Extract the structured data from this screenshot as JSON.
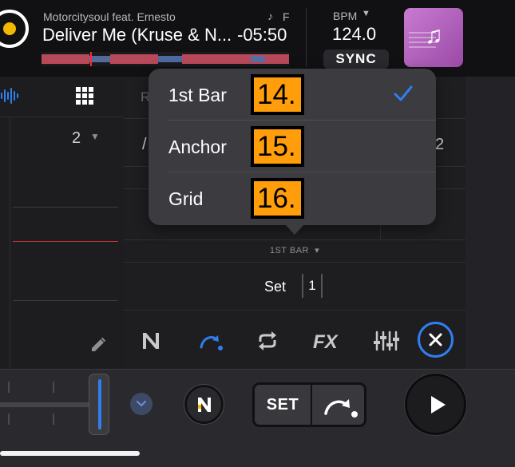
{
  "deck": {
    "artist": "Motorcitysoul feat. Ernesto",
    "key_label": "F",
    "title": "Deliver Me (Kruse & N...",
    "time_remaining": "-05:50",
    "bpm_label": "BPM",
    "bpm_value": "124.0",
    "sync_label": "SYNC"
  },
  "left_strip": {
    "bars_value": "2"
  },
  "grid_table": {
    "col1_header_partial": "R",
    "row1_left_partial": "/",
    "row1_right_partial": "2"
  },
  "popover": {
    "items": [
      {
        "label": "1st Bar",
        "badge": "14.",
        "selected": true
      },
      {
        "label": "Anchor",
        "badge": "15.",
        "selected": false
      },
      {
        "label": "Grid",
        "badge": "16.",
        "selected": false
      }
    ]
  },
  "grid_panel": {
    "mode_label": "1ST BAR",
    "set_label": "Set",
    "set_value": "1"
  },
  "toolbar": {
    "icons": [
      "n-icon",
      "cue-arrow-icon",
      "loop-icon",
      "fx-icon",
      "mixer-sliders-icon",
      "close-icon"
    ]
  },
  "transport": {
    "set_label": "SET"
  },
  "colors": {
    "accent_blue": "#2f7ff0",
    "badge_orange": "#ff9d0a",
    "deck_yellow": "#f5b800",
    "album_purple": "#b360bf"
  }
}
